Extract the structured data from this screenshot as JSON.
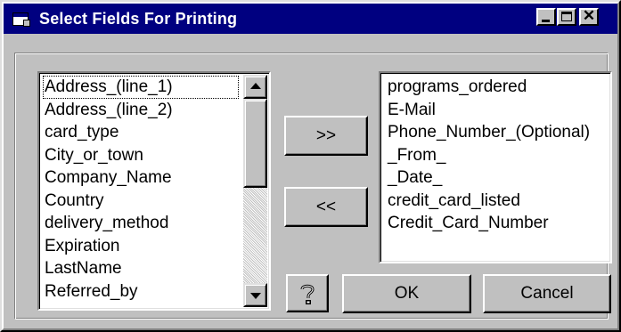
{
  "window": {
    "title": "Select Fields For Printing"
  },
  "title_controls": {
    "minimize": "_",
    "maximize": "□",
    "close": "✕"
  },
  "available_fields": [
    "Address_(line_1)",
    "Address_(line_2)",
    "card_type",
    "City_or_town",
    "Company_Name",
    "Country",
    "delivery_method",
    "Expiration",
    "LastName",
    "Referred_by"
  ],
  "selected_fields": [
    "programs_ordered",
    "E-Mail",
    "Phone_Number_(Optional)",
    "_From_",
    "_Date_",
    "credit_card_listed",
    "Credit_Card_Number"
  ],
  "buttons": {
    "add": ">>",
    "remove": "<<",
    "ok": "OK",
    "cancel": "Cancel"
  },
  "icons": {
    "app": "form-window-icon",
    "help": "question-mark-icon",
    "scroll_up": "arrow-up-icon",
    "scroll_down": "arrow-down-icon"
  },
  "colors": {
    "titlebar": "#000080",
    "face": "#c0c0c0"
  }
}
